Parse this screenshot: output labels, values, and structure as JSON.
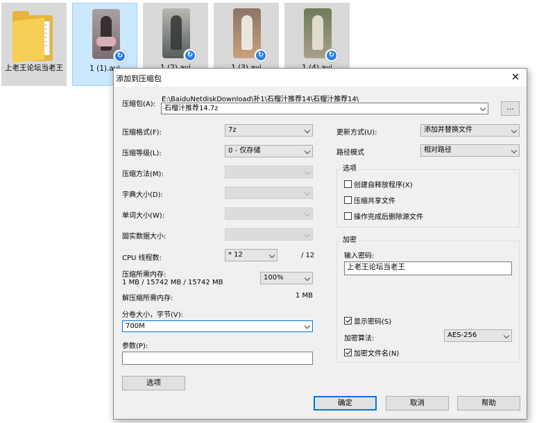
{
  "files": [
    {
      "label": "上老王论坛当老王"
    },
    {
      "label": "1 (1).avi"
    },
    {
      "label": "1 (2).avi"
    },
    {
      "label": "1 (3).avi"
    },
    {
      "label": "1 (4).avi"
    }
  ],
  "dialog": {
    "title": "添加到压缩包",
    "archive_label": "压缩包(A):",
    "archive_path": "E:\\BaiduNetdiskDownload\\补1\\石榴汁推荐14\\石榴汁推荐14\\",
    "archive_name": "石榴汁推荐14.7z",
    "browse_label": "...",
    "format_label": "压缩格式(F):",
    "format_value": "7z",
    "level_label": "压缩等级(L):",
    "level_value": "0 - 仅存储",
    "method_label": "压缩方法(M):",
    "dict_label": "字典大小(D):",
    "word_label": "单词大小(W):",
    "solid_label": "固实数据大小:",
    "cpu_label": "CPU 线程数:",
    "cpu_value": "* 12",
    "cpu_total": "/ 12",
    "mem_label": "压缩所需内存:",
    "mem_value": "1 MB / 15742 MB / 15742 MB",
    "mem_percent": "100%",
    "decomp_label": "解压缩所需内存:",
    "decomp_value": "1 MB",
    "split_label": "分卷大小，字节(V):",
    "split_value": "700M",
    "params_label": "参数(P):",
    "params_value": "",
    "options_button": "选项",
    "update_label": "更新方式(U):",
    "update_value": "添加并替换文件",
    "path_label": "路径模式",
    "path_value": "相对路径",
    "options_group": "选项",
    "opt_sfx": "创建自释放程序(X)",
    "opt_shared": "压缩共享文件",
    "opt_delete": "操作完成后删除源文件",
    "encrypt_group": "加密",
    "password_label": "输入密码:",
    "password_value": "上老王论坛当老王",
    "show_password": "显示密码(S)",
    "enc_method_label": "加密算法:",
    "enc_method_value": "AES-256",
    "encrypt_names": "加密文件名(N)",
    "ok": "确定",
    "cancel": "取消",
    "help": "帮助"
  }
}
